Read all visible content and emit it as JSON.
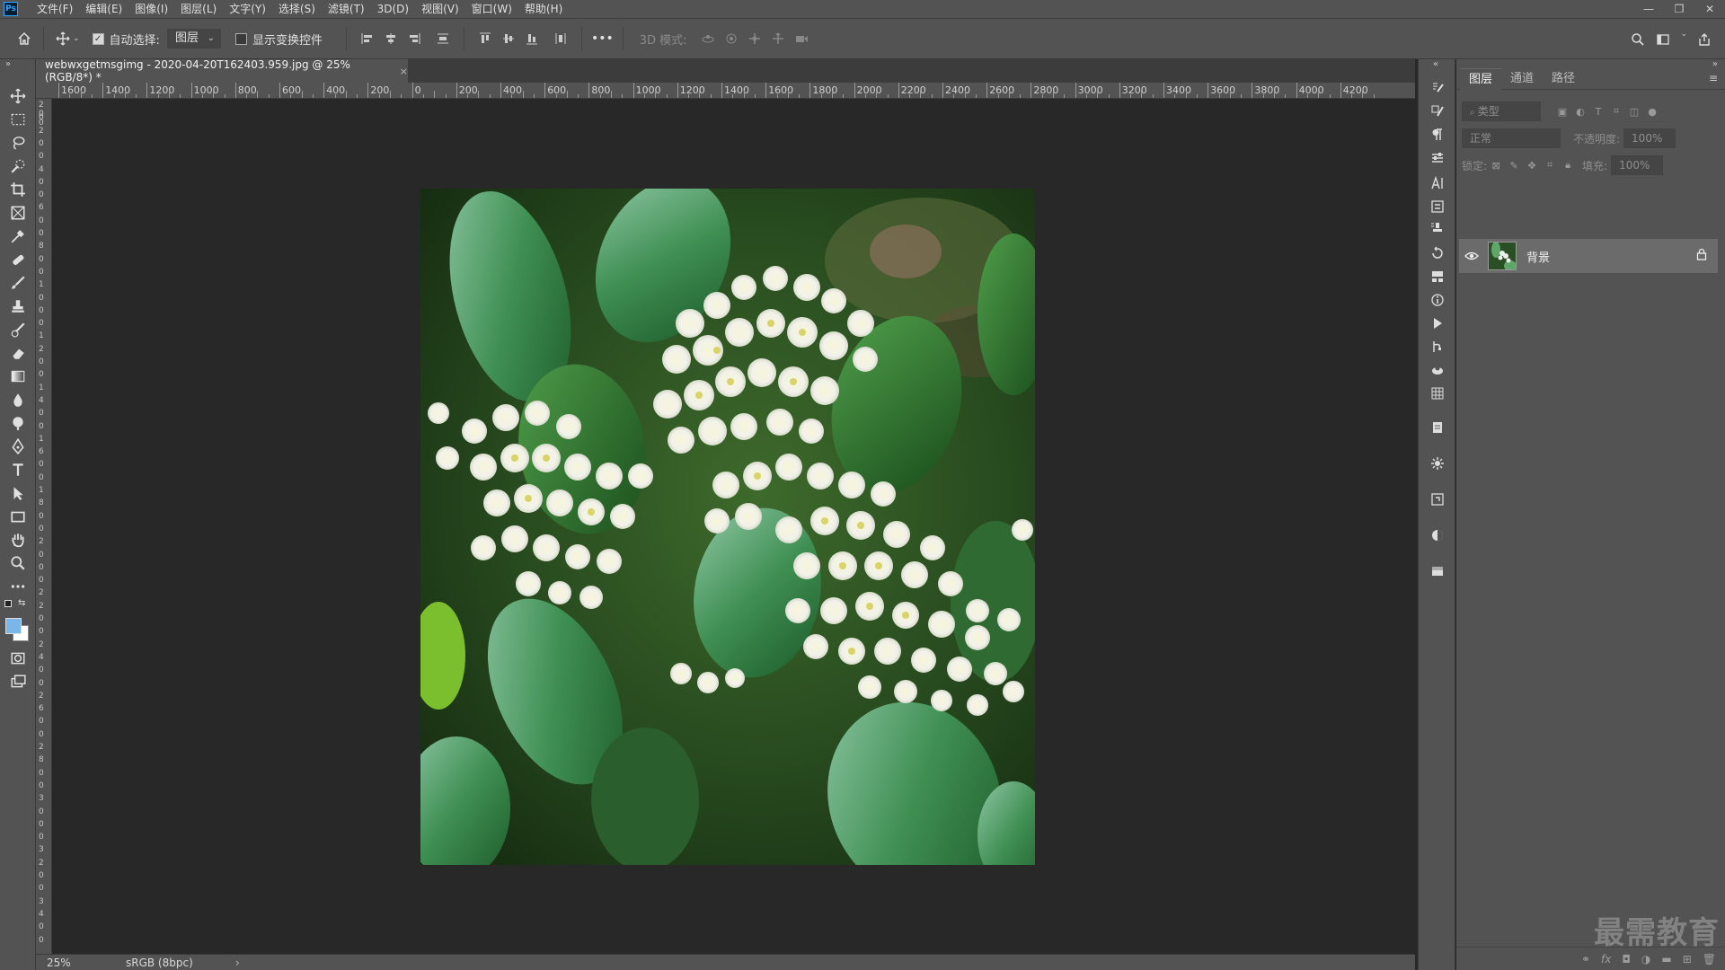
{
  "app": {
    "logo_text": "Ps",
    "menu": [
      "文件(F)",
      "编辑(E)",
      "图像(I)",
      "图层(L)",
      "文字(Y)",
      "选择(S)",
      "滤镜(T)",
      "3D(D)",
      "视图(V)",
      "窗口(W)",
      "帮助(H)"
    ],
    "window_controls": [
      "—",
      "❐",
      "✕"
    ]
  },
  "options_bar": {
    "auto_select_label": "自动选择:",
    "auto_select_checked": true,
    "auto_select_target": "图层",
    "show_transform_label": "显示变换控件",
    "show_transform_checked": false,
    "more_label": "•••",
    "mode_3d_label": "3D 模式:"
  },
  "document": {
    "tab_title": "webwxgetmsgimg - 2020-04-20T162403.959.jpg @ 25%(RGB/8*) *",
    "close_glyph": "×",
    "ruler_top_labels": [
      "1600",
      "1400",
      "1200",
      "1000",
      "800",
      "600",
      "400",
      "200",
      "0",
      "200",
      "400",
      "600",
      "800",
      "1000",
      "1200",
      "1400",
      "1600",
      "1800",
      "2000",
      "2200",
      "2400",
      "2600",
      "2800",
      "3000",
      "3200",
      "3400",
      "3600",
      "3800",
      "4000",
      "4200"
    ],
    "ruler_left_labels": [
      "200",
      "0",
      "2",
      "0",
      "0",
      "4",
      "0",
      "0",
      "6",
      "0",
      "0",
      "8",
      "0",
      "0",
      "1",
      "0",
      "0",
      "0",
      "1",
      "2",
      "0",
      "0",
      "1",
      "4",
      "0",
      "0",
      "1",
      "6",
      "0",
      "0",
      "1",
      "8",
      "0",
      "0",
      "2",
      "0",
      "0",
      "0",
      "2",
      "2",
      "0",
      "0",
      "2",
      "4",
      "0",
      "0",
      "2",
      "6",
      "0",
      "0",
      "2",
      "8",
      "0",
      "0",
      "3",
      "0",
      "0",
      "0",
      "3",
      "2",
      "0",
      "0",
      "3",
      "4",
      "0",
      "0"
    ]
  },
  "status_bar": {
    "zoom": "25%",
    "color_profile": "sRGB (8bpc)",
    "arrow": "›"
  },
  "layers_panel": {
    "tabs": [
      "图层",
      "通道",
      "路径"
    ],
    "active_tab": 0,
    "filter_placeholder": "类型",
    "blend_mode": "正常",
    "opacity_label": "不透明度:",
    "opacity_value": "100%",
    "lock_label": "锁定:",
    "fill_label": "填充:",
    "fill_value": "100%",
    "layers": [
      {
        "name": "背景",
        "visible": true,
        "locked": true
      }
    ],
    "bottom_icons": [
      "link-icon",
      "fx-icon",
      "mask-icon",
      "adjustment-icon",
      "folder-icon",
      "new-layer-icon",
      "trash-icon"
    ]
  },
  "watermark_text": "最需教育",
  "colors": {
    "foreground": "#7ab7e8",
    "background": "#ffffff",
    "ui_panel": "#535353",
    "canvas_bg": "#282828"
  }
}
